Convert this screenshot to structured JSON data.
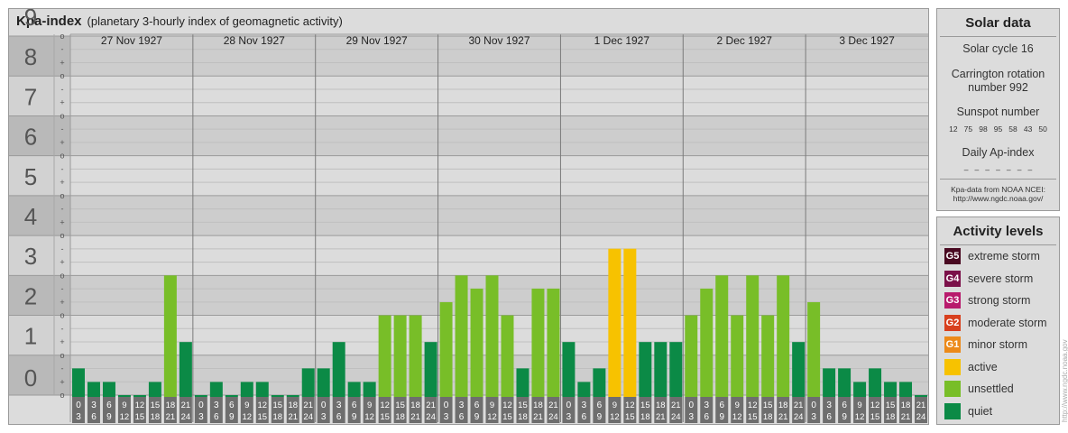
{
  "header": {
    "title": "Kpa-index",
    "subtitle": "(planetary 3-hourly index of geomagnetic activity)"
  },
  "chart_data": {
    "type": "bar",
    "ylim": [
      0,
      9
    ],
    "y_major_labels": [
      "0",
      "1",
      "2",
      "3",
      "4",
      "5",
      "6",
      "7",
      "8",
      "9"
    ],
    "third_labels": [
      "o",
      "+",
      "-"
    ],
    "days": [
      "27 Nov 1927",
      "28 Nov 1927",
      "29 Nov 1927",
      "30 Nov 1927",
      "1 Dec 1927",
      "2 Dec 1927",
      "3 Dec 1927"
    ],
    "interval_labels": [
      [
        "0",
        "3"
      ],
      [
        "3",
        "6"
      ],
      [
        "6",
        "9"
      ],
      [
        "9",
        "12"
      ],
      [
        "12",
        "15"
      ],
      [
        "15",
        "18"
      ],
      [
        "18",
        "21"
      ],
      [
        "21",
        "24"
      ]
    ],
    "values": [
      [
        0.67,
        0.33,
        0.33,
        0,
        0,
        0.33,
        3.0,
        1.33
      ],
      [
        0,
        0.33,
        0,
        0.33,
        0.33,
        0,
        0,
        0.67
      ],
      [
        0.67,
        1.33,
        0.33,
        0.33,
        2.0,
        2.0,
        2.0,
        1.33
      ],
      [
        2.33,
        3.0,
        2.67,
        3.0,
        2.0,
        0.67,
        2.67,
        2.67
      ],
      [
        1.33,
        0.33,
        0.67,
        3.67,
        3.67,
        1.33,
        1.33,
        1.33
      ],
      [
        2.0,
        2.67,
        3.0,
        2.0,
        3.0,
        2.0,
        3.0,
        1.33
      ],
      [
        2.33,
        0.67,
        0.67,
        0.33,
        0.67,
        0.33,
        0.33,
        0
      ]
    ],
    "level_colors": {
      "quiet": "#0b8a46",
      "unsettled": "#78be28",
      "active": "#f7c200"
    }
  },
  "solar": {
    "title": "Solar data",
    "cycle": "Solar cycle 16",
    "carrington_line1": "Carrington rotation",
    "carrington_line2": "number 992",
    "sunspot_label": "Sunspot number",
    "sunspot_values": "12   75   98   95   58   43   50",
    "ap_label": "Daily Ap-index",
    "ap_values": "–   –   –   –   –   –   –",
    "source_line1": "Kpa-data from NOAA NCEI:",
    "source_line2": "http://www.ngdc.noaa.gov/"
  },
  "activity": {
    "title": "Activity levels",
    "items": [
      {
        "code": "G5",
        "label": "extreme storm",
        "color": "#4a0a22"
      },
      {
        "code": "G4",
        "label": "severe storm",
        "color": "#7b1049"
      },
      {
        "code": "G3",
        "label": "strong storm",
        "color": "#b81a6c"
      },
      {
        "code": "G2",
        "label": "moderate storm",
        "color": "#d8401e"
      },
      {
        "code": "G1",
        "label": "minor storm",
        "color": "#ec8a1a"
      },
      {
        "code": "",
        "label": "active",
        "color": "#f7c200"
      },
      {
        "code": "",
        "label": "unsettled",
        "color": "#78be28"
      },
      {
        "code": "",
        "label": "quiet",
        "color": "#0b8a46"
      }
    ]
  },
  "watermark": "http://www.ngdc.noaa.gov"
}
